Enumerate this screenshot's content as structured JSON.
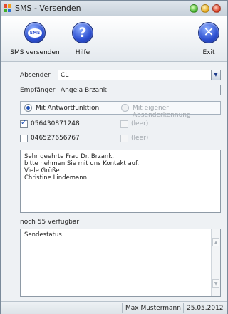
{
  "window": {
    "title": "SMS - Versenden",
    "app_icon": "sms-app-icon",
    "buttons": [
      "minimize",
      "maximize",
      "close"
    ]
  },
  "toolbar": {
    "send": {
      "label": "SMS versenden",
      "icon": "sms-icon",
      "icon_text": "SMS"
    },
    "help": {
      "label": "Hilfe",
      "icon": "help-icon",
      "icon_text": "?"
    },
    "exit": {
      "label": "Exit",
      "icon": "close-icon",
      "icon_text": "✕"
    }
  },
  "form": {
    "sender_label": "Absender",
    "sender_value": "CL",
    "recipient_label": "Empfänger",
    "recipient_value": "Angela Brzank",
    "radio": {
      "option_reply": "Mit Antwortfunktion",
      "option_own_sender": "Mit eigener Absenderkennung",
      "selected": "option_reply"
    },
    "numbers": [
      {
        "value": "056430871248",
        "checked": true
      },
      {
        "value": "046527656767",
        "checked": false
      },
      {
        "value": "(leer)",
        "checked": false
      },
      {
        "value": "(leer)",
        "checked": false
      }
    ],
    "message_lines": [
      "Sehr geehrte Frau Dr. Brzank,",
      "bitte nehmen Sie mit uns Kontakt auf.",
      "Viele Grüße",
      "Christine Lindemann"
    ],
    "remaining_text": "noch 55 verfügbar",
    "send_status_label": "Sendestatus"
  },
  "statusbar": {
    "user": "Max Mustermann",
    "date": "25.05.2012"
  },
  "colors": {
    "accent": "#2c4fd0",
    "window_bg": "#eef1f4",
    "border": "#8e9aa6"
  }
}
